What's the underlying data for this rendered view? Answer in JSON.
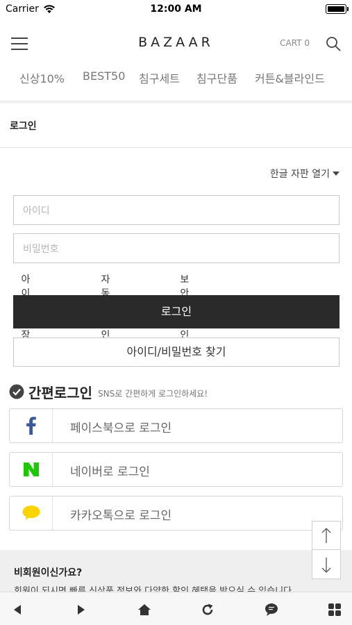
{
  "status_bar": {
    "carrier": "Carrier",
    "time": "12:00 AM"
  },
  "header": {
    "logo": "BAZAAR",
    "cart": "CART 0"
  },
  "nav": {
    "items": [
      "신상10%",
      "BEST50",
      "침구세트",
      "침구단품",
      "커튼&블라인드"
    ]
  },
  "page_title": "로그인",
  "keyboard_toggle": "한글 자판 열기",
  "form": {
    "id_placeholder": "아이디",
    "pw_placeholder": "비밀번호",
    "save_id": "아이디 저장",
    "auto_login": "자동 로그인",
    "secure_login": "보안 로그인",
    "login_button": "로그인",
    "find_button": "아이디/비밀번호 찾기"
  },
  "sns": {
    "title": "간편로그인",
    "subtitle": "SNS로 간편하게 로그인하세요!",
    "facebook": "페이스북으로 로그인",
    "naver": "네이버로 로그인",
    "kakao": "카카오톡으로 로그인"
  },
  "guest": {
    "title": "비회원이신가요?",
    "text": "회원이 되시면 빠른 신상품 정보와 다양한 할인 혜택을 받으실 수 있습니다."
  },
  "colors": {
    "facebook": "#3b5998",
    "naver": "#1ec800",
    "kakao": "#fbd400",
    "dark": "#2a2a2a"
  },
  "icons": [
    "wifi-icon",
    "battery-icon",
    "menu-icon",
    "search-icon",
    "caret-down-icon",
    "check-icon",
    "facebook-icon",
    "naver-icon",
    "kakao-icon",
    "arrow-up-icon",
    "arrow-down-icon",
    "back-icon",
    "forward-icon",
    "home-icon",
    "refresh-icon",
    "chat-icon",
    "grid-icon"
  ]
}
